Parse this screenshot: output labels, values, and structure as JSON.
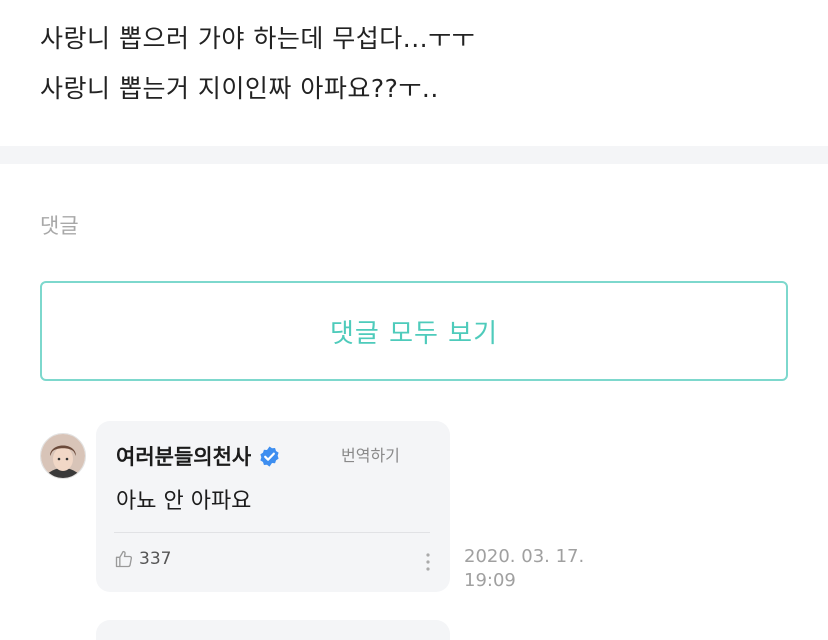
{
  "post": {
    "lines": [
      "사랑니 뽑으러 가야 하는데 무섭다...ㅜㅜ",
      "사랑니 뽑는거 지이인짜 아파요??ㅜ.."
    ]
  },
  "comments_section": {
    "label": "댓글",
    "view_all_label": "댓글 모두 보기"
  },
  "comments": [
    {
      "author": "여러분들의천사",
      "verified": true,
      "translate_label": "번역하기",
      "text": "아뇨 안 아파요",
      "likes": "337",
      "date": "2020. 03. 17.",
      "time": "19:09"
    }
  ],
  "icons": {
    "verified": "verified-badge-icon",
    "like": "thumbs-up-icon",
    "more": "more-vertical-icon"
  },
  "colors": {
    "accent": "#4ecbbb",
    "accent_border": "#7dd8cd",
    "verified_blue": "#3d8ef0",
    "bubble_bg": "#f4f5f7"
  }
}
